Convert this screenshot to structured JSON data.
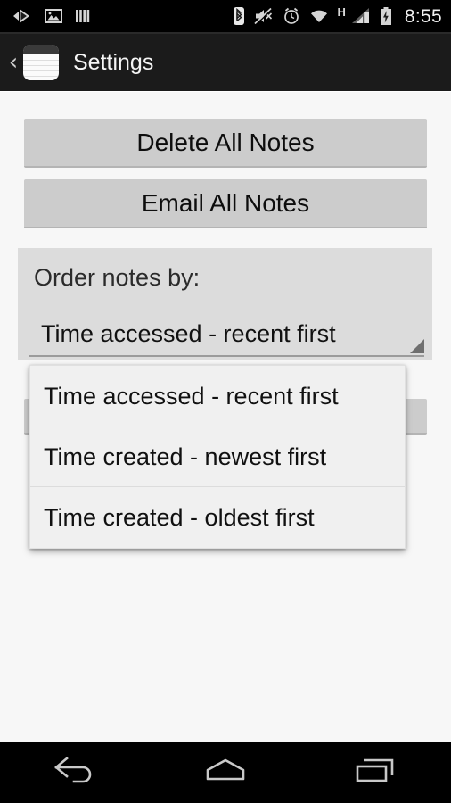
{
  "status_bar": {
    "left_icons": [
      {
        "name": "media-play-icon",
        "glyph": "play-arrow"
      },
      {
        "name": "gallery-image-icon",
        "glyph": "photo"
      },
      {
        "name": "bars-icon",
        "glyph": "vertical-bars"
      }
    ],
    "right_icons": [
      {
        "name": "bluetooth-icon",
        "glyph": "bluetooth"
      },
      {
        "name": "volume-mute-icon",
        "glyph": "speaker-muted"
      },
      {
        "name": "alarm-clock-icon",
        "glyph": "alarm"
      },
      {
        "name": "wifi-icon",
        "glyph": "wifi"
      },
      {
        "name": "network-type-icon",
        "glyph": "H"
      },
      {
        "name": "signal-bars-icon",
        "glyph": "signal"
      },
      {
        "name": "battery-charging-icon",
        "glyph": "battery-bolt"
      }
    ],
    "network_type": "H",
    "clock": "8:55",
    "background_color": "#000000"
  },
  "action_bar": {
    "back_chevron": "‹",
    "app_icon_name": "notepad-app-icon",
    "title": "Settings",
    "background_color": "#1b1b1b",
    "title_color": "#f5f5f5"
  },
  "content": {
    "background_color": "#f7f7f7",
    "buttons": [
      {
        "id": "delete-all-notes",
        "label": "Delete All Notes"
      },
      {
        "id": "email-all-notes",
        "label": "Email All Notes"
      }
    ],
    "button_color": "#cccccc",
    "order_section": {
      "label": "Order notes by:",
      "background_color": "#dcdcdc",
      "spinner_value": "Time accessed - recent first",
      "spinner_indicator": "triangle-down-right"
    }
  },
  "dropdown": {
    "open": true,
    "background_color": "#f0f0f0",
    "selected_index": 0,
    "options": [
      "Time accessed - recent first",
      "Time created - newest first",
      "Time created - oldest first"
    ]
  },
  "nav_bar": {
    "background_color": "#000000",
    "buttons": [
      {
        "id": "back",
        "name": "nav-back-button"
      },
      {
        "id": "home",
        "name": "nav-home-button"
      },
      {
        "id": "recents",
        "name": "nav-recents-button"
      }
    ]
  }
}
